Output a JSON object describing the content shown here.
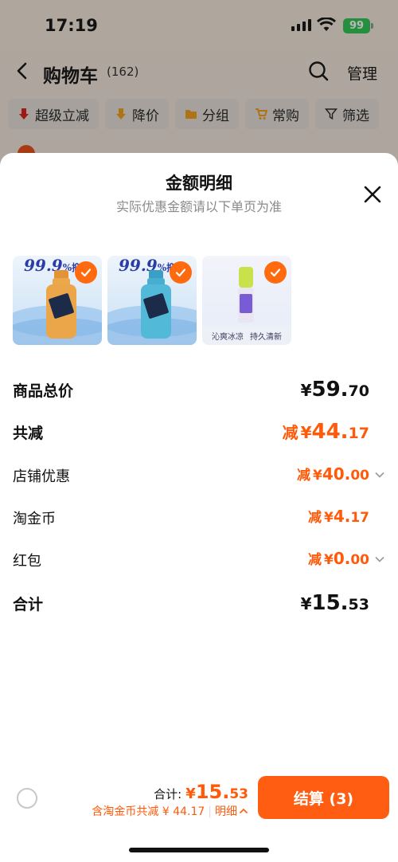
{
  "status_bar": {
    "time": "17:19",
    "battery": "99"
  },
  "nav": {
    "title": "购物车",
    "count": "(162)",
    "manage": "管理"
  },
  "filters": [
    {
      "label": "超级立减",
      "icon": "red-down-arrow-icon"
    },
    {
      "label": "降价",
      "icon": "price-drop-icon"
    },
    {
      "label": "分组",
      "icon": "folder-icon"
    },
    {
      "label": "常购",
      "icon": "cart-icon"
    },
    {
      "label": "筛选",
      "icon": "filter-icon"
    }
  ],
  "sheet": {
    "title": "金额明细",
    "subtitle": "实际优惠金额请以下单页为准",
    "products": [
      {
        "badge_num": "99.9",
        "badge_unit": "%",
        "badge_text": "抑菌",
        "color": "#e9a441"
      },
      {
        "badge_num": "99.9",
        "badge_unit": "%",
        "badge_text": "抑菌",
        "color": "#4fb6d6"
      },
      {
        "strip_left": "沁爽冰凉",
        "strip_right": "持久清新",
        "color": "#c9e14a"
      }
    ],
    "rows": [
      {
        "label": "商品总价",
        "prefix": "",
        "currency": "¥",
        "int": "59.",
        "dec": "70"
      },
      {
        "label": "共减",
        "prefix": "减",
        "currency": "¥",
        "int": "44.",
        "dec": "17"
      },
      {
        "label": "店铺优惠",
        "prefix": "减",
        "currency": "¥",
        "int": "40.",
        "dec": "00"
      },
      {
        "label": "淘金币",
        "prefix": "减",
        "currency": "¥",
        "int": "4.",
        "dec": "17"
      },
      {
        "label": "红包",
        "prefix": "减",
        "currency": "¥",
        "int": "0.",
        "dec": "00"
      },
      {
        "label": "合计",
        "prefix": "",
        "currency": "¥",
        "int": "15.",
        "dec": "53"
      }
    ]
  },
  "footer": {
    "total_label": "合计:",
    "total_currency": "¥",
    "total_int": "15.",
    "total_dec": "53",
    "savings_text": "含淘金币共减 ¥ 44.17",
    "detail_label": "明细",
    "checkout_label": "结算 (3)"
  },
  "colors": {
    "accent": "#ff5a0a",
    "checkout_bg": "#ff5e12",
    "battery": "#34c759"
  }
}
